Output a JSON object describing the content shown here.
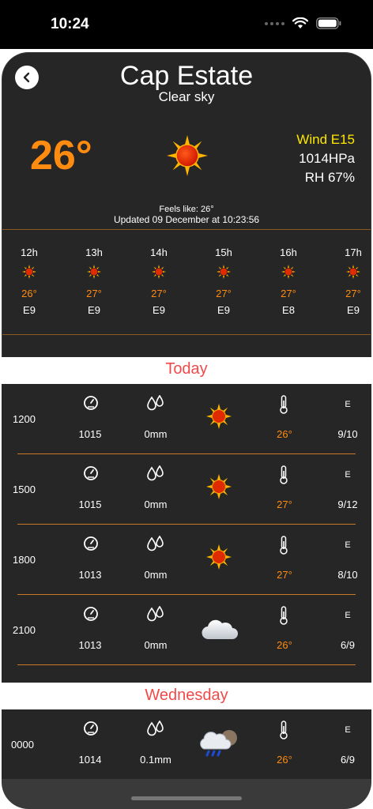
{
  "status": {
    "time": "10:24"
  },
  "header": {
    "city": "Cap Estate",
    "condition": "Clear sky",
    "temp": "26°",
    "wind": "Wind E15",
    "pressure": "1014HPa",
    "humidity": "RH 67%",
    "feels_like": "Feels like:  26°",
    "updated": "Updated 09 December at 10:23:56"
  },
  "hourly": [
    {
      "hour": "12h",
      "temp": "26°",
      "wind": "E9"
    },
    {
      "hour": "13h",
      "temp": "27°",
      "wind": "E9"
    },
    {
      "hour": "14h",
      "temp": "27°",
      "wind": "E9"
    },
    {
      "hour": "15h",
      "temp": "27°",
      "wind": "E9"
    },
    {
      "hour": "16h",
      "temp": "27°",
      "wind": "E8"
    },
    {
      "hour": "17h",
      "temp": "27°",
      "wind": "E9"
    }
  ],
  "today": {
    "title": "Today",
    "rows": [
      {
        "time": "1200",
        "pressure": "1015",
        "rain": "0mm",
        "weather_icon": "sun-icon",
        "temp": "26°",
        "dir": "E",
        "wind": "9/10"
      },
      {
        "time": "1500",
        "pressure": "1015",
        "rain": "0mm",
        "weather_icon": "sun-icon",
        "temp": "27°",
        "dir": "E",
        "wind": "9/12"
      },
      {
        "time": "1800",
        "pressure": "1013",
        "rain": "0mm",
        "weather_icon": "sun-icon",
        "temp": "27°",
        "dir": "E",
        "wind": "8/10"
      },
      {
        "time": "2100",
        "pressure": "1013",
        "rain": "0mm",
        "weather_icon": "cloud-icon",
        "temp": "26°",
        "dir": "E",
        "wind": "6/9"
      }
    ]
  },
  "wednesday": {
    "title": "Wednesday",
    "rows": [
      {
        "time": "0000",
        "pressure": "1014",
        "rain": "0.1mm",
        "weather_icon": "rain-cloud-icon",
        "temp": "26°",
        "dir": "E",
        "wind": "6/9"
      }
    ]
  },
  "colors": {
    "accent_orange": "#ff8c10",
    "wind_yellow": "#ffe800",
    "section_red": "#f04a4a",
    "panel": "#262626"
  }
}
